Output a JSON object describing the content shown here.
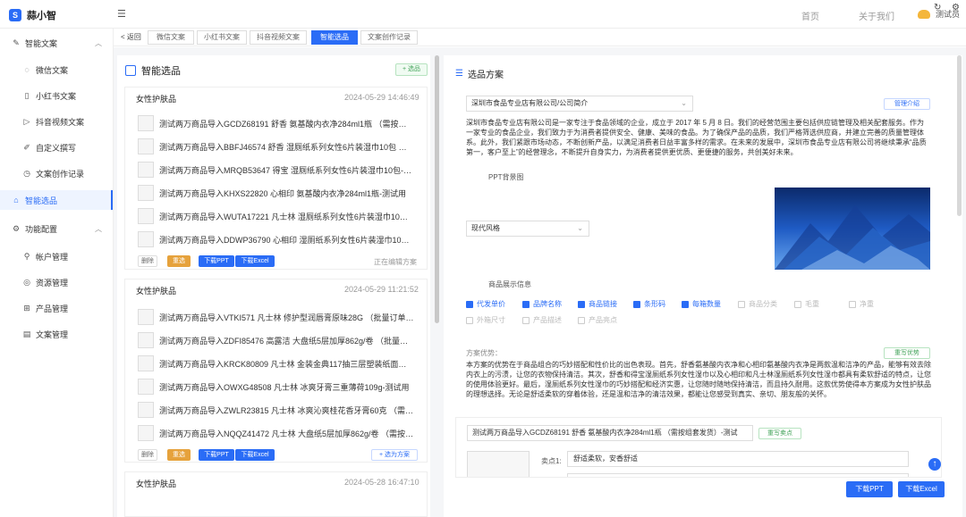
{
  "header": {
    "logo_glyph": "S",
    "app_title": "蒜小智",
    "nav_home": "首页",
    "nav_about": "关于我们",
    "user_name": "测试员"
  },
  "sidebar": {
    "items": [
      {
        "label": "智能文案",
        "icon": "pen-icon"
      },
      {
        "label": "微信文案",
        "icon": "chat-icon"
      },
      {
        "label": "小红书文案",
        "icon": "book-icon"
      },
      {
        "label": "抖音视频文案",
        "icon": "play-icon"
      },
      {
        "label": "自定义撰写",
        "icon": "edit-icon"
      },
      {
        "label": "文案创作记录",
        "icon": "history-icon"
      },
      {
        "label": "智能选品",
        "icon": "bag-icon"
      },
      {
        "label": "功能配置",
        "icon": "settings-icon"
      },
      {
        "label": "帐户管理",
        "icon": "account-icon"
      },
      {
        "label": "资源管理",
        "icon": "resource-icon"
      },
      {
        "label": "产品管理",
        "icon": "grid-icon"
      },
      {
        "label": "文案管理",
        "icon": "doc-icon"
      }
    ]
  },
  "tabs": {
    "back": "< 返回",
    "items": [
      "微信文案",
      "小红书文案",
      "抖音视频文案",
      "智能选品",
      "文案创作记录"
    ],
    "active_index": 3
  },
  "left_panel": {
    "title": "智能选品",
    "add_label": "+ 选品",
    "cards": [
      {
        "category": "女性护肤品",
        "time": "2024-05-29 14:46:49",
        "products": [
          "测试两万商品导入GCDZ68191 舒香 氨基酸内衣净284ml1瓶 （需按组套发...",
          "测试两万商品导入BBFJ46574 舒香 湿厕纸系列女性6片装湿巾10包 （客户定...",
          "测试两万商品导入MRQB53647 得宝 湿厕纸系列女性6片装湿巾10包-测试用",
          "测试两万商品导入KHXS22820 心相印 氨基酸内衣净284ml1瓶-测试用",
          "测试两万商品导入WUTA17221 凡士林 湿厕纸系列女性6片装湿巾10包-测试用",
          "测试两万商品导入DDWP36790 心相印 湿厕纸系列女性6片装湿巾10包 （客..."
        ],
        "btn_delete": "删除",
        "btn_select": "重选",
        "btn_ppt": "下载PPT",
        "btn_excel": "下载Excel",
        "status": "正在编辑方案"
      },
      {
        "category": "女性护肤品",
        "time": "2024-05-29 11:21:52",
        "products": [
          "测试两万商品导入VTKI571 凡士林 修护型润唇膏原味28G （批量订单请提前...",
          "测试两万商品导入ZDFI85476 高露洁 大盘纸5层加厚862g/卷 （批量订单请...",
          "测试两万商品导入KRCK80809 凡士林 金装金典117抽三层塑装纸面巾4包 （...",
          "测试两万商品导入OWXG48508 凡士林 冰爽牙膏三重薄荷109g-测试用",
          "测试两万商品导入ZWLR23815 凡士林 冰爽沁爽桂花香牙膏60克 （需按组套...",
          "测试两万商品导入NQQZ41472 凡士林 大盘纸5层加厚862g/卷 （需按组套..."
        ],
        "btn_delete": "删除",
        "btn_select": "重选",
        "btn_ppt": "下载PPT",
        "btn_excel": "下载Excel",
        "btn_plan": "+ 选为方案"
      },
      {
        "category": "女性护肤品",
        "time": "2024-05-28 16:47:10"
      }
    ]
  },
  "right_panel": {
    "title": "选品方案",
    "company": "深圳市食品专业店有限公司/公司简介",
    "manage_btn": "管理介绍",
    "intro": "深圳市食品专业店有限公司是一家专注于食品领域的企业，成立于 2017 年 5 月 8 日。我们的经营范围主要包括供应链管理及相关配套服务。作为一家专业的食品企业，我们致力于为消费者提供安全、健康、美味的食品。为了确保产品的品质，我们严格筛选供应商，并建立完善的质量管理体系。此外，我们紧跟市场动态，不断创新产品，以满足消费者日益丰富多样的需求。在未来的发展中，深圳市食品专业店有限公司将继续秉承“品质第一，客户至上”的经营理念，不断提升自身实力，为消费者提供更优质、更便捷的服务，共创美好未来。",
    "ppt_bg_label": "PPT背景图",
    "ppt_bg_value": "现代风格",
    "display_label": "商品展示信息",
    "checkboxes": [
      {
        "label": "代发单价",
        "checked": true
      },
      {
        "label": "品牌名称",
        "checked": true
      },
      {
        "label": "商品链接",
        "checked": true
      },
      {
        "label": "条形码",
        "checked": true
      },
      {
        "label": "每箱数量",
        "checked": true
      },
      {
        "label": "商品分类",
        "checked": false
      },
      {
        "label": "毛重",
        "checked": false
      },
      {
        "label": "净重",
        "checked": false
      },
      {
        "label": "外箱尺寸",
        "checked": false
      },
      {
        "label": "产品描述",
        "checked": false
      },
      {
        "label": "产品亮点",
        "checked": false
      }
    ],
    "advantages_label": "方案优势：",
    "advantages_btn": "重写优势",
    "advantages_text": "本方案的优势在于商品组合的巧妙搭配和性价比的出色表现。首先，舒香氨基酸内衣净和心相印氨基酸内衣净是两款温和洁净的产品，能够有效去除内衣上的污渍，让您的衣物保持清洁。其次，舒香和得宝湿厕纸系列女性湿巾以及心相印和凡士林湿厕纸系列女性湿巾都具有柔软舒适的特点，让您的使用体验更好。最后，湿厕纸系列女性湿巾的巧妙搭配和经济实惠，让您随时随地保持清洁，而且持久耐用。这款优势使得本方案成为女性护肤品的理想选择。无论是舒适柔软的穿着体验，还是温和洁净的清洁效果，都能让您感受到真实、亲切、朋友般的关怀。",
    "product_name": "测试两万商品导入GCDZ68191 舒香 氨基酸内衣净284ml1瓶 （需按组套发货）-测试",
    "product_rewrite_btn": "重写卖点",
    "point_label": "卖点1:",
    "point_value": "舒适柔软，安香舒适",
    "btn_ppt": "下载PPT",
    "btn_excel": "下载Excel"
  }
}
